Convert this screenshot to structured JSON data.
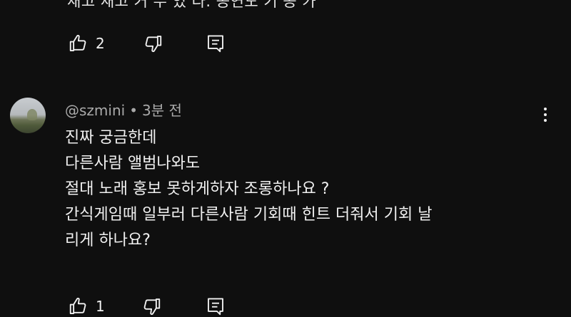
{
  "previous_comment": {
    "cut_text": "재고 재고 거 두 었 다. 공연도 기 공 가",
    "like_count": "2"
  },
  "comment": {
    "author": "@szmini",
    "separator": "•",
    "time": "3분 전",
    "lines": [
      "진짜 궁금한데",
      "다른사람 앨범나와도",
      "절대 노래 홍보 못하게하자 조롱하나요 ?",
      "간식게임때 일부러 다른사람 기회때 힌트 더줘서 기회 날",
      "리게 하나요?"
    ],
    "like_count": "1"
  },
  "icons": {
    "like": "thumbs-up-icon",
    "dislike": "thumbs-down-icon",
    "reply": "comment-reply-icon",
    "more": "more-vertical-icon"
  },
  "colors": {
    "background": "#0f0f0f",
    "text": "#f1f1f1",
    "meta": "#aaaaaa"
  }
}
